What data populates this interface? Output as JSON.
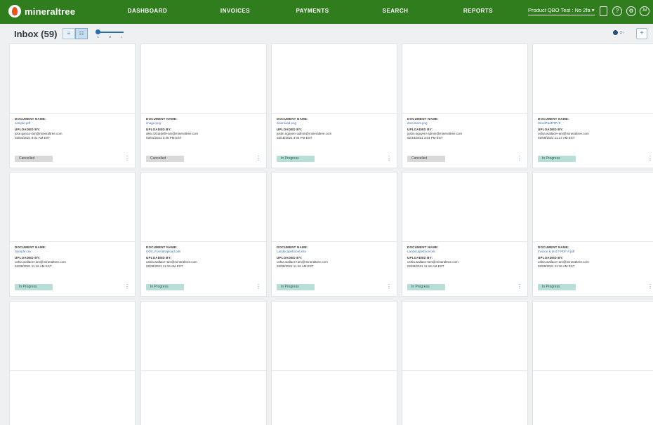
{
  "brand": "mineraltree",
  "nav": [
    "DASHBOARD",
    "INVOICES",
    "PAYMENTS",
    "SEARCH",
    "REPORTS"
  ],
  "company_selector": "Product QBO Test : No 2fa ▾",
  "user_initials": "JM",
  "toolbar": {
    "title": "Inbox (59)",
    "list_icon": "≡",
    "grid_icon": "☷",
    "slider_labels": [
      "S",
      "M",
      "L"
    ],
    "pager_text": "2 ›",
    "add_label": "+"
  },
  "card_labels": {
    "doc_name": "DOCUMENT NAME:",
    "uploaded_by": "UPLOADED BY:"
  },
  "cards": [
    {
      "name": "sample.pdf",
      "uploader": "jose.garcia+am@mineraltree.com",
      "date": "03/04/2021 9:01 AM EST",
      "status": "Cancelled",
      "status_type": "cancelled"
    },
    {
      "name": "image.png",
      "uploader": "alex.rizzardelli+am@mineraltree.com",
      "date": "03/01/2021 3:48 PM EST",
      "status": "Cancelled",
      "status_type": "cancelled"
    },
    {
      "name": "download.png",
      "uploader": "justin.nguyen+admin@mineraltree.com",
      "date": "02/18/2021 3:04 PM EST",
      "status": "In Progress",
      "status_type": "progress"
    },
    {
      "name": "document.png",
      "uploader": "justin.nguyen+admin@mineraltree.com",
      "date": "02/18/2021 3:04 PM EST",
      "status": "Cancelled",
      "status_type": "cancelled"
    },
    {
      "name": "WordPadRTF.rtf",
      "uploader": "ushia.wallace+am@mineraltree.com",
      "date": "02/09/2021 11:17 AM EST",
      "status": "In Progress",
      "status_type": "progress"
    },
    {
      "name": "Sample.csv",
      "uploader": "ushia.wallace+am@mineraltree.com",
      "date": "02/09/2021 11:16 AM EST",
      "status": "In Progress",
      "status_type": "progress"
    },
    {
      "name": "ODS_FormatUpload.ods",
      "uploader": "ushia.wallace+am@mineraltree.com",
      "date": "02/09/2021 11:16 AM EST",
      "status": "In Progress",
      "status_type": "progress"
    },
    {
      "name": "LandscapeExcel.xlsx",
      "uploader": "ushia.wallace+am@mineraltree.com",
      "date": "02/09/2021 11:16 AM EST",
      "status": "In Progress",
      "status_type": "progress"
    },
    {
      "name": "LandscapeExcel.xls",
      "uploader": "ushia.wallace+am@mineraltree.com",
      "date": "02/09/2021 11:16 AM EST",
      "status": "In Progress",
      "status_type": "progress"
    },
    {
      "name": "Invoice & text # PDF #.pdf",
      "uploader": "ushia.wallace+am@mineraltree.com",
      "date": "02/09/2021 11:16 AM EST",
      "status": "In Progress",
      "status_type": "progress"
    },
    {
      "name": "",
      "uploader": "",
      "date": "",
      "status": "",
      "status_type": ""
    },
    {
      "name": "",
      "uploader": "",
      "date": "",
      "status": "",
      "status_type": ""
    },
    {
      "name": "",
      "uploader": "",
      "date": "",
      "status": "",
      "status_type": ""
    },
    {
      "name": "",
      "uploader": "",
      "date": "",
      "status": "",
      "status_type": ""
    },
    {
      "name": "",
      "uploader": "",
      "date": "",
      "status": "",
      "status_type": ""
    }
  ],
  "colors": {
    "header": "#2f7d1d",
    "link": "#3d6fb6",
    "progress_bg": "#b9ddd7",
    "cancelled_bg": "#d9d9d9"
  }
}
